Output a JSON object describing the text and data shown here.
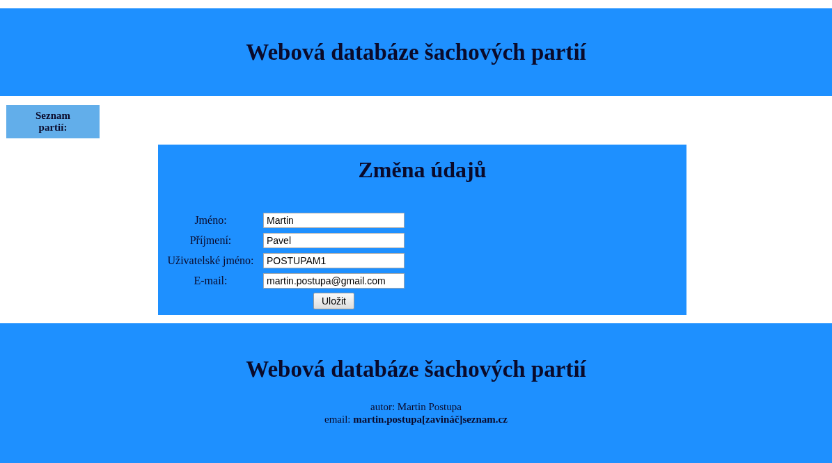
{
  "header": {
    "title": "Webová databáze šachových partií"
  },
  "sidebar": {
    "link": "Seznam partií:"
  },
  "form": {
    "title": "Změna údajů",
    "fields": [
      {
        "label": "Jméno:",
        "value": "Martin"
      },
      {
        "label": "Příjmení:",
        "value": "Pavel"
      },
      {
        "label": "Uživatelské jméno:",
        "value": "POSTUPAM1"
      },
      {
        "label": "E-mail:",
        "value": "martin.postupa@gmail.com"
      }
    ],
    "button": "Uložit"
  },
  "footer": {
    "title": "Webová databáze šachových partií",
    "author": "autor: Martin Postupa",
    "email": "email: **martin.postupa[zavináč]seznam.cz**"
  }
}
